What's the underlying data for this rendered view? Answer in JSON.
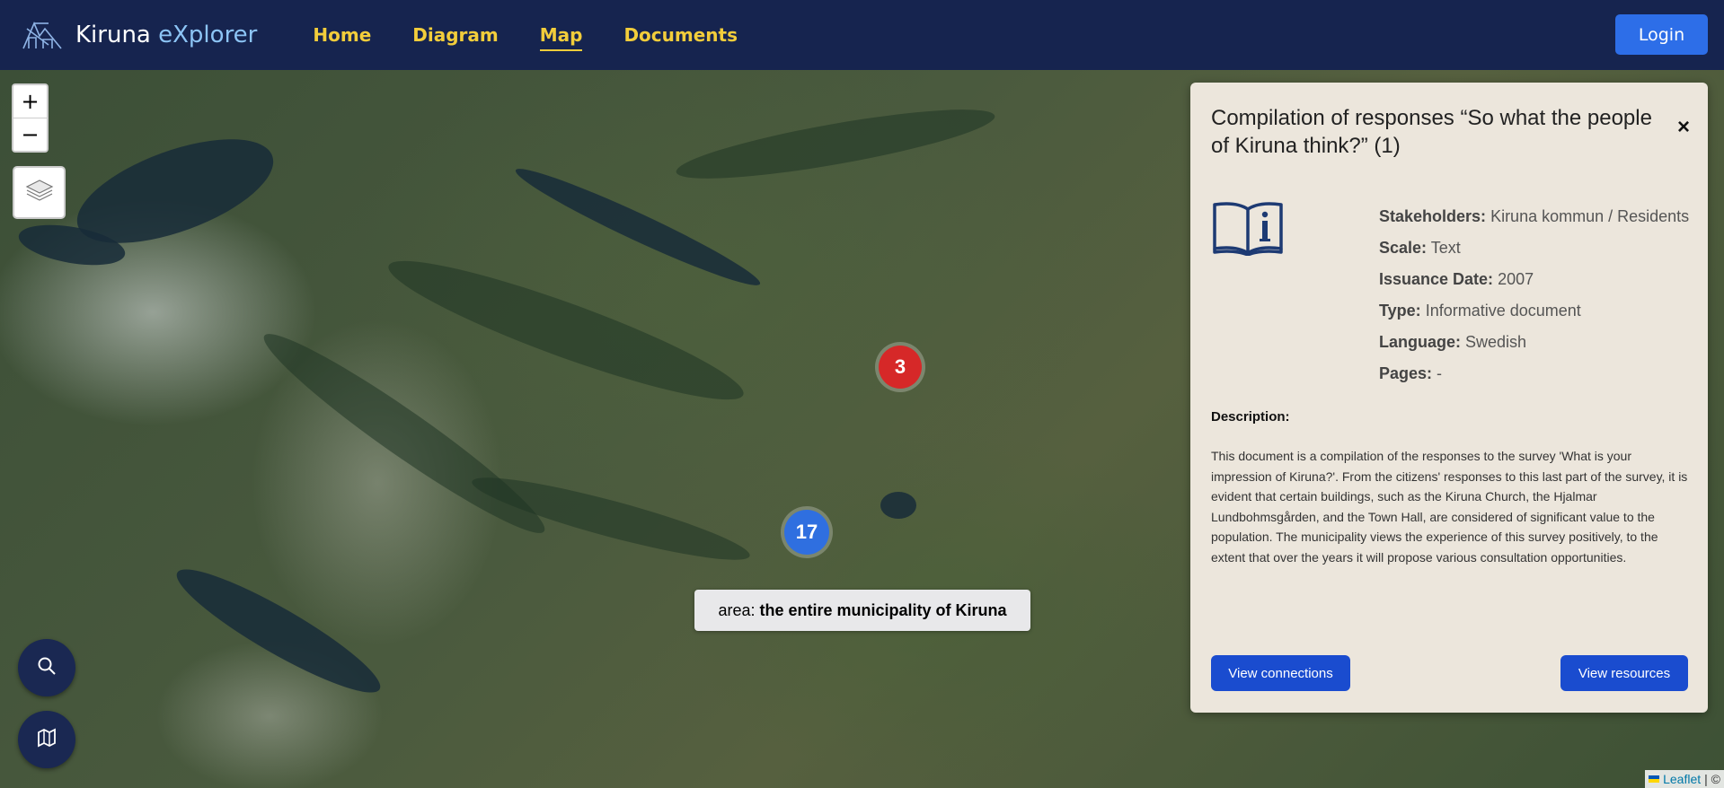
{
  "navbar": {
    "brand": {
      "name": "Kiruna",
      "accent": "eXplorer"
    },
    "links": [
      {
        "label": "Home",
        "active": false
      },
      {
        "label": "Diagram",
        "active": false
      },
      {
        "label": "Map",
        "active": true
      },
      {
        "label": "Documents",
        "active": false
      }
    ],
    "login_label": "Login"
  },
  "map": {
    "zoom_in": "+",
    "zoom_out": "−",
    "clusters": [
      {
        "count": "3",
        "color": "#d62828"
      },
      {
        "count": "17",
        "color": "#2f6fe0"
      }
    ],
    "area_tooltip": {
      "prefix": "area:",
      "value": "the entire municipality of Kiruna"
    },
    "attribution": {
      "link": "Leaflet",
      "suffix": "| ©"
    },
    "controls": [
      "layers-icon",
      "search-icon",
      "map-icon"
    ]
  },
  "panel": {
    "title": "Compilation of responses “So what the people of Kiruna think?” (1)",
    "close": "×",
    "icon": "book-info-icon",
    "fields": [
      {
        "key": "Stakeholders:",
        "value": "Kiruna kommun / Residents"
      },
      {
        "key": "Scale:",
        "value": "Text"
      },
      {
        "key": "Issuance Date:",
        "value": "2007"
      },
      {
        "key": "Type:",
        "value": "Informative document"
      },
      {
        "key": "Language:",
        "value": "Swedish"
      },
      {
        "key": "Pages:",
        "value": "-"
      }
    ],
    "description_label": "Description:",
    "description": "This document is a compilation of the responses to the survey 'What is your impression of Kiruna?'. From the citizens' responses to this last part of the survey, it is evident that certain buildings, such as the Kiruna Church, the Hjalmar Lundbohmsgården, and the Town Hall, are considered of significant value to the population. The municipality views the experience of this survey positively, to the extent that over the years it will propose various consultation opportunities.",
    "buttons": {
      "connections": "View connections",
      "resources": "View resources"
    }
  },
  "colors": {
    "navbar": "#16244f",
    "nav_link": "#f2cd3b",
    "login": "#2d6ee8",
    "panel": "#ece6dc",
    "panel_button": "#1a4ccf"
  }
}
